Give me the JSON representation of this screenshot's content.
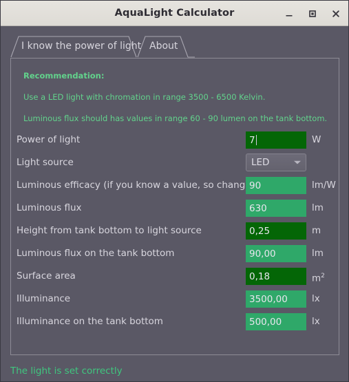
{
  "window": {
    "title": "AquaLight Calculator",
    "controls": [
      {
        "name": "minimize-button",
        "glyph": "minimize"
      },
      {
        "name": "maximize-button",
        "glyph": "maximize"
      },
      {
        "name": "close-button",
        "glyph": "close"
      }
    ]
  },
  "tabs": [
    {
      "label": "I know the power of light",
      "active": true
    },
    {
      "label": "About",
      "active": false
    }
  ],
  "recommendation": {
    "title": "Recommendation:",
    "lines": [
      "Use a LED light with chromation in range 3500 - 6500 Kelvin.",
      "Luminous flux should has values in range 60 - 90 lumen on the tank bottom."
    ]
  },
  "form": {
    "rows": [
      {
        "label": "Power of light",
        "value": "7",
        "unit": "W",
        "kind": "input",
        "state": "focused"
      },
      {
        "label": "Light source",
        "value": "LED",
        "unit": "",
        "kind": "combo",
        "state": "enabled"
      },
      {
        "label": "Luminous efficacy (if you know a value, so change",
        "value": "90",
        "unit": "lm/W",
        "kind": "input",
        "state": "readonly"
      },
      {
        "label": "Luminous flux",
        "value": "630",
        "unit": "lm",
        "kind": "input",
        "state": "readonly"
      },
      {
        "label": "Height from tank bottom to light source",
        "value": "0,25",
        "unit": "m",
        "kind": "input",
        "state": "editable"
      },
      {
        "label": "Luminous flux on the tank bottom",
        "value": "90,00",
        "unit": "lm",
        "kind": "input",
        "state": "readonly"
      },
      {
        "label": "Surface area",
        "value": "0,18",
        "unit": "m2",
        "kind": "input",
        "state": "editable"
      },
      {
        "label": "Illuminance",
        "value": "3500,00",
        "unit": "lx",
        "kind": "input",
        "state": "readonly"
      },
      {
        "label": "Illuminance on the tank bottom",
        "value": "500,00",
        "unit": "lx",
        "kind": "input",
        "state": "readonly"
      }
    ]
  },
  "status": {
    "message": "The light is set correctly"
  },
  "colors": {
    "window_bg": "#5a5865",
    "titlebar_bg": "#e0ded9",
    "accent_green": "#62d38c",
    "field_readonly": "#2fa869",
    "field_editable": "#046606",
    "status_green": "#3fc77f"
  }
}
